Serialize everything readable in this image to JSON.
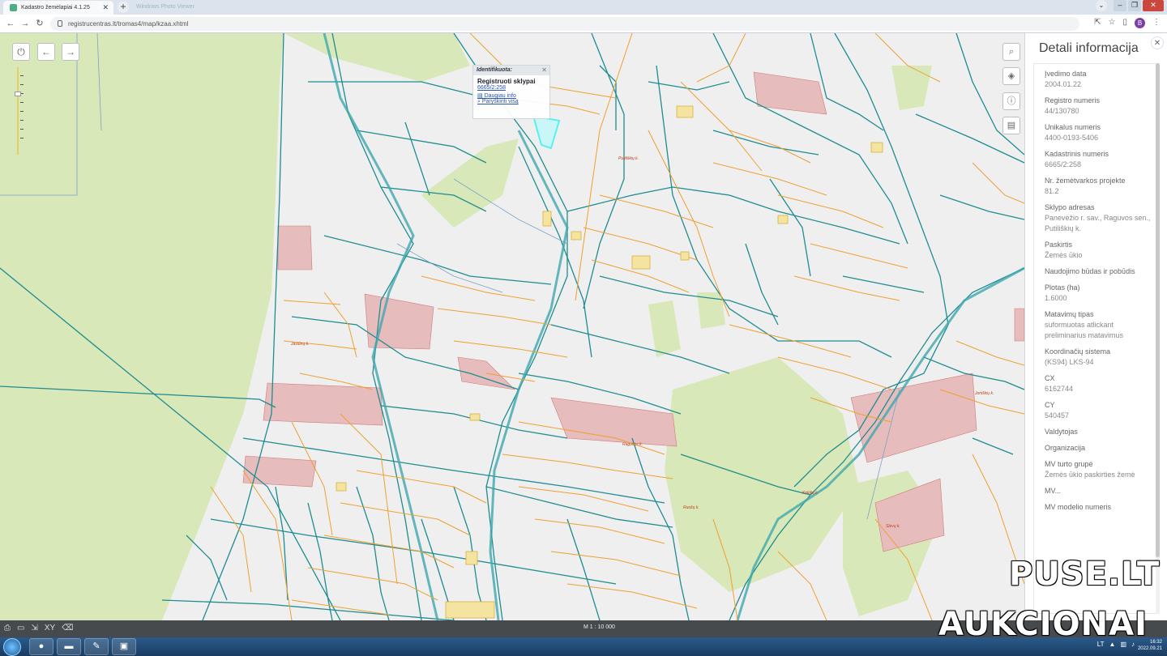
{
  "browser": {
    "tab_title": "Kadastro žemėlapiai 4.1.25",
    "tab2_title": "Windows Photo Viewer",
    "url": "registrucentras.lt/tromas4/map/kzaa.xhtml",
    "avatar_letter": "B",
    "favicon_color": "#4caf84"
  },
  "map": {
    "popup": {
      "heading": "Identifikuota:",
      "title": "Registruoti sklypai",
      "parcel_id": "6665/2:258",
      "more_info": "Daugiau info",
      "show_all": "Paryškinti visą"
    },
    "places": [
      "Putiliškių k.",
      "Jasiūnų k.",
      "Raguvos k.",
      "Kirkilių k.",
      "Joniškių k.",
      "Ruožų k.",
      "Slevų k."
    ],
    "colors": {
      "teal": "#1f8c8f",
      "orange": "#f0a030",
      "green": "#d7e8b7",
      "red_parcel": "#e4b9b9",
      "highlight": "#59f0f0"
    }
  },
  "statusbar": {
    "scale": "M 1 : 10 000",
    "xy_label": "XY"
  },
  "panel": {
    "title": "Detali informacija",
    "fields": [
      {
        "label": "Įvedimo data",
        "value": "2004.01.22"
      },
      {
        "label": "Registro numeris",
        "value": "44/130780"
      },
      {
        "label": "Unikalus numeris",
        "value": "4400-0193-5406"
      },
      {
        "label": "Kadastrinis numeris",
        "value": "6665/2:258"
      },
      {
        "label": "Nr. žemėtvarkos projekte",
        "value": "81.2"
      },
      {
        "label": "Sklypo adresas",
        "value": "Panevėžio r. sav., Raguvos sen., Putiliškių k."
      },
      {
        "label": "Paskirtis",
        "value": "Žemės ūkio"
      },
      {
        "label": "Naudojimo būdas ir pobūdis",
        "value": ""
      },
      {
        "label": "Plotas (ha)",
        "value": "1.6000"
      },
      {
        "label": "Matavimų tipas",
        "value": "suformuotas atlickant preliminarius matavimus"
      },
      {
        "label": "Koordinačių sistema",
        "value": "(KS94) LKS-94"
      },
      {
        "label": "CX",
        "value": "6162744"
      },
      {
        "label": "CY",
        "value": "540457"
      },
      {
        "label": "Valdytojas",
        "value": ""
      },
      {
        "label": "Organizacija",
        "value": ""
      },
      {
        "label": "MV turto grupė",
        "value": "Žemės ūkio paskirties žemė"
      },
      {
        "label": "MV...",
        "value": ""
      },
      {
        "label": "MV modelio numeris",
        "value": ""
      }
    ]
  },
  "watermark": {
    "line1": "PUSE.LT",
    "line2": "AUKCIONAI"
  },
  "taskbar": {
    "apps": [
      "chrome",
      "explorer",
      "pdf",
      "viewer"
    ],
    "lang": "LT",
    "time": "16:32",
    "date": "2022.09.21"
  }
}
